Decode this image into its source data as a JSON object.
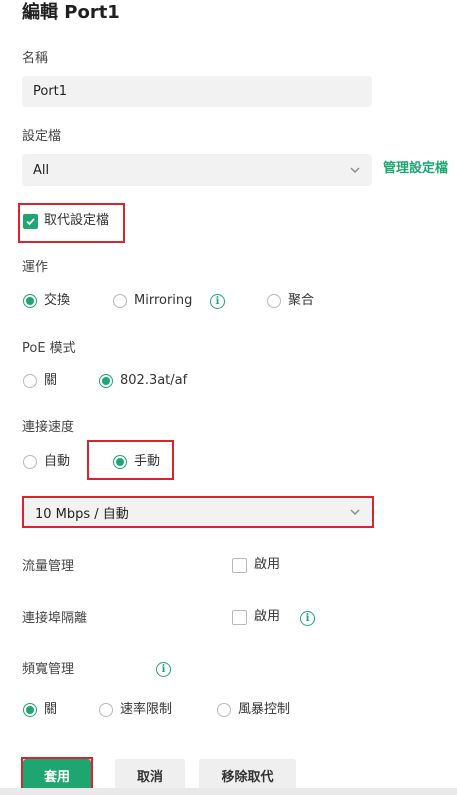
{
  "page": {
    "title": "編輯 Port1"
  },
  "name_section": {
    "label": "名稱",
    "value": "Port1"
  },
  "profile_section": {
    "label": "設定檔",
    "value": "All",
    "manage_link": "管理設定檔"
  },
  "override_profile": {
    "label": "取代設定檔",
    "checked": true
  },
  "operation": {
    "label": "運作",
    "options": [
      {
        "label": "交換",
        "selected": true
      },
      {
        "label": "Mirroring",
        "selected": false
      },
      {
        "label": "聚合",
        "selected": false
      }
    ],
    "info_icon": "info-icon"
  },
  "poe_mode": {
    "label": "PoE 模式",
    "options": [
      {
        "label": "關",
        "selected": false
      },
      {
        "label": "802.3at/af",
        "selected": true
      }
    ]
  },
  "link_speed": {
    "label": "連接速度",
    "options": [
      {
        "label": "自動",
        "selected": false
      },
      {
        "label": "手動",
        "selected": true
      }
    ],
    "select_value": "10 Mbps / 自動"
  },
  "flow_control": {
    "label": "流量管理",
    "checkbox_label": "啟用",
    "checked": false
  },
  "port_isolation": {
    "label": "連接埠隔離",
    "checkbox_label": "啟用",
    "checked": false
  },
  "bandwidth": {
    "label": "頻寬管理",
    "options": [
      {
        "label": "關",
        "selected": true
      },
      {
        "label": "速率限制",
        "selected": false
      },
      {
        "label": "風暴控制",
        "selected": false
      }
    ]
  },
  "actions": {
    "apply": "套用",
    "cancel": "取消",
    "remove_override": "移除取代"
  },
  "colors": {
    "accent": "#1ea672",
    "highlight": "#d9242e"
  }
}
